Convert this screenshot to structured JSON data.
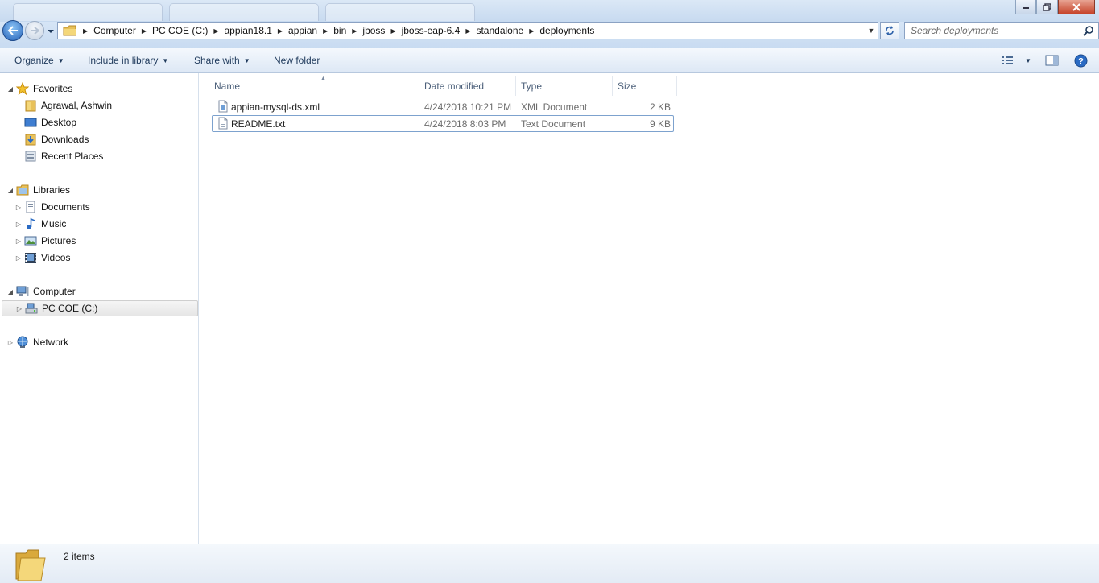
{
  "address": {
    "crumbs": [
      "Computer",
      "PC COE (C:)",
      "appian18.1",
      "appian",
      "bin",
      "jboss",
      "jboss-eap-6.4",
      "standalone",
      "deployments"
    ]
  },
  "search": {
    "placeholder": "Search deployments"
  },
  "toolbar": {
    "organize": "Organize",
    "include_in_library": "Include in library",
    "share_with": "Share with",
    "new_folder": "New folder"
  },
  "nav": {
    "favorites": "Favorites",
    "favorites_items": [
      "Agrawal, Ashwin",
      "Desktop",
      "Downloads",
      "Recent Places"
    ],
    "libraries": "Libraries",
    "libraries_items": [
      "Documents",
      "Music",
      "Pictures",
      "Videos"
    ],
    "computer": "Computer",
    "computer_items": [
      "PC COE (C:)"
    ],
    "network": "Network"
  },
  "columns": {
    "name": "Name",
    "date_modified": "Date modified",
    "type": "Type",
    "size": "Size"
  },
  "files": [
    {
      "name": "appian-mysql-ds.xml",
      "date": "4/24/2018 10:21 PM",
      "type": "XML Document",
      "size": "2 KB",
      "icon": "xml-file-icon"
    },
    {
      "name": "README.txt",
      "date": "4/24/2018 8:03 PM",
      "type": "Text Document",
      "size": "9 KB",
      "icon": "text-file-icon"
    }
  ],
  "status": {
    "item_count": "2 items"
  },
  "colors": {
    "accent": "#1e395b",
    "selection": "#7da2ce",
    "chrome": "#c8dbf1"
  }
}
